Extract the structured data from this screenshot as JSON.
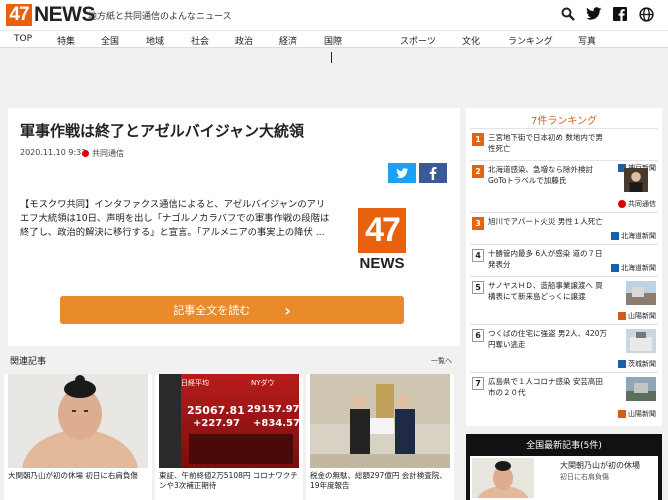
{
  "header": {
    "logo_num": "47",
    "logo_word": "NEWS",
    "tagline": "地方紙と共同通信のよんなニュース"
  },
  "nav": [
    "TOP",
    "特集",
    "全国",
    "地域",
    "社会",
    "政治",
    "経済",
    "国際",
    "スポーツ",
    "文化",
    "ランキング",
    "写真"
  ],
  "article": {
    "title": "軍事作戦は終了とアゼルバイジャン大統領",
    "date": "2020.11.10 9:32",
    "source": "共同通信",
    "body": "【モスクワ共同】インタファクス通信によると、アゼルバイジャンのアリエフ大統領は10日、声明を出し「ナゴルノカラバフでの軍事作戦の段階は終了し、政治的解決に移行する」と宣言。「アルメニアの事実上の降伏 ...",
    "logo_num": "47",
    "logo_word": "NEWS",
    "read_more": "記事全文を読む",
    "read_arrow": "›"
  },
  "related": {
    "title": "関連記事",
    "more": "一覧へ",
    "items": [
      {
        "caption": "大関朝乃山が初の休場 初日に右肩負傷"
      },
      {
        "caption": "東証、午前終値2万5108円 コロナワクチンや3次補正期待",
        "board_label": "日経平均",
        "board_val1": "25067.81",
        "board_val2": "+227.97",
        "board_label2": "NYダウ",
        "board_val3": "29157.97",
        "board_val4": "+834.57"
      },
      {
        "caption": "税金の無駄、総額297億円 会計検査院、19年度報告"
      }
    ]
  },
  "ranking": {
    "title": "7件ランキング",
    "items": [
      {
        "num": "1",
        "text": "三宮地下街で日本初め 数地内で男性死亡",
        "source": "神戸新聞"
      },
      {
        "num": "2",
        "text": "北海道感染、急増なら除外検討 GoToトラベルで加藤氏",
        "source": "共同通信"
      },
      {
        "num": "3",
        "text": "旭川でアパート火災 男性１人死亡",
        "source": "北海道新聞"
      },
      {
        "num": "4",
        "text": "十勝管内最多 6人が感染 道の７日発表分",
        "source": "北海道新聞"
      },
      {
        "num": "5",
        "text": "サノヤスＨＤ、造船事業譲渡へ 買構表にて新来島どっくに譲渡",
        "source": "山陽新聞"
      },
      {
        "num": "6",
        "text": "つくばの住宅に強盗 男2人、420万円奪い逃走",
        "source": "茨城新聞"
      },
      {
        "num": "7",
        "text": "広島県で１人コロナ感染 安芸高田市の２０代",
        "source": "山陽新聞"
      }
    ]
  },
  "latest": {
    "title": "全国最新記事(5件)",
    "text": "大関朝乃山が初の休場",
    "sub": "初日に右肩負傷"
  }
}
